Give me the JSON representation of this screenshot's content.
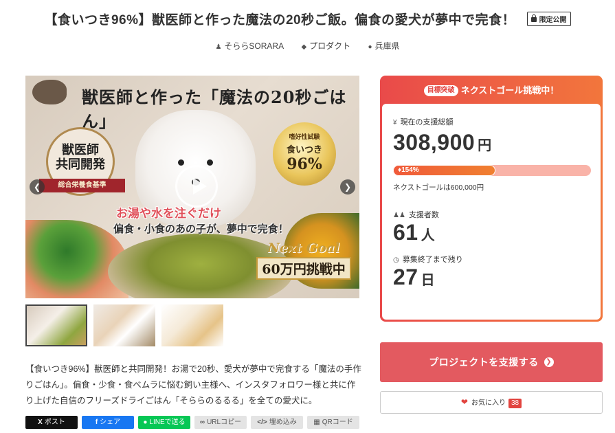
{
  "page": {
    "title": "【食いつき96%】獣医師と作った魔法の20秒ご飯。偏食の愛犬が夢中で完食！",
    "limited_badge": "限定公開"
  },
  "meta": {
    "author": "そららSORARA",
    "category": "プロダクト",
    "location": "兵庫県"
  },
  "main_image": {
    "headline": "獣医師と作った「魔法の20秒ごはん」",
    "seal_line1": "獣医師",
    "seal_line2": "共同開発",
    "ribbon": "総合栄養食基準",
    "medal_small": "嗜好性試験",
    "medal_main": "食いつき",
    "medal_num": "96%",
    "sub1": "お湯や水を注ぐだけ",
    "sub2": "偏食・小食のあの子が、夢中で完食！",
    "next_goal_en": "Next Goal",
    "next_goal_jp": "60万円挑戦中"
  },
  "description": "【食いつき96%】獣医師と共同開発！お湯で20秒、愛犬が夢中で完食する「魔法の手作りごはん」。偏食・少食・食べムラに悩む飼い主様へ、インスタフォロワー様と共に作り上げた自信のフリーズドライごはん「そららのるるる」を全ての愛犬に。",
  "share": {
    "x": "ポスト",
    "facebook": "シェア",
    "line": "LINEで送る",
    "url_copy": "URLコピー",
    "embed": "埋め込み",
    "qr": "QRコード"
  },
  "goal": {
    "badge": "目標突破",
    "header": "ネクストゴール挑戦中！",
    "total_label": "現在の支援総額",
    "total_amount": "308,900",
    "total_unit": "円",
    "progress_label": "154%",
    "progress_value": 154,
    "next_goal_text": "ネクストゴールは600,000円",
    "backers_label": "支援者数",
    "backers_count": "61",
    "backers_unit": "人",
    "remaining_label": "募集終了まで残り",
    "remaining_days": "27",
    "remaining_unit": "日"
  },
  "actions": {
    "support_label": "プロジェクトを支援する",
    "favorite_label": "お気に入り",
    "favorite_count": "38"
  },
  "colors": {
    "accent_red": "#e35a60",
    "goal_gradient_start": "#e94a4a",
    "goal_gradient_end": "#f2763c",
    "line_green": "#06c755",
    "facebook_blue": "#1877f2"
  },
  "icons": {
    "author": "user-icon",
    "category": "tag-icon",
    "location": "map-pin-icon",
    "yen": "yen-icon",
    "backers": "users-icon",
    "remaining": "clock-icon",
    "favorite": "heart-icon"
  }
}
